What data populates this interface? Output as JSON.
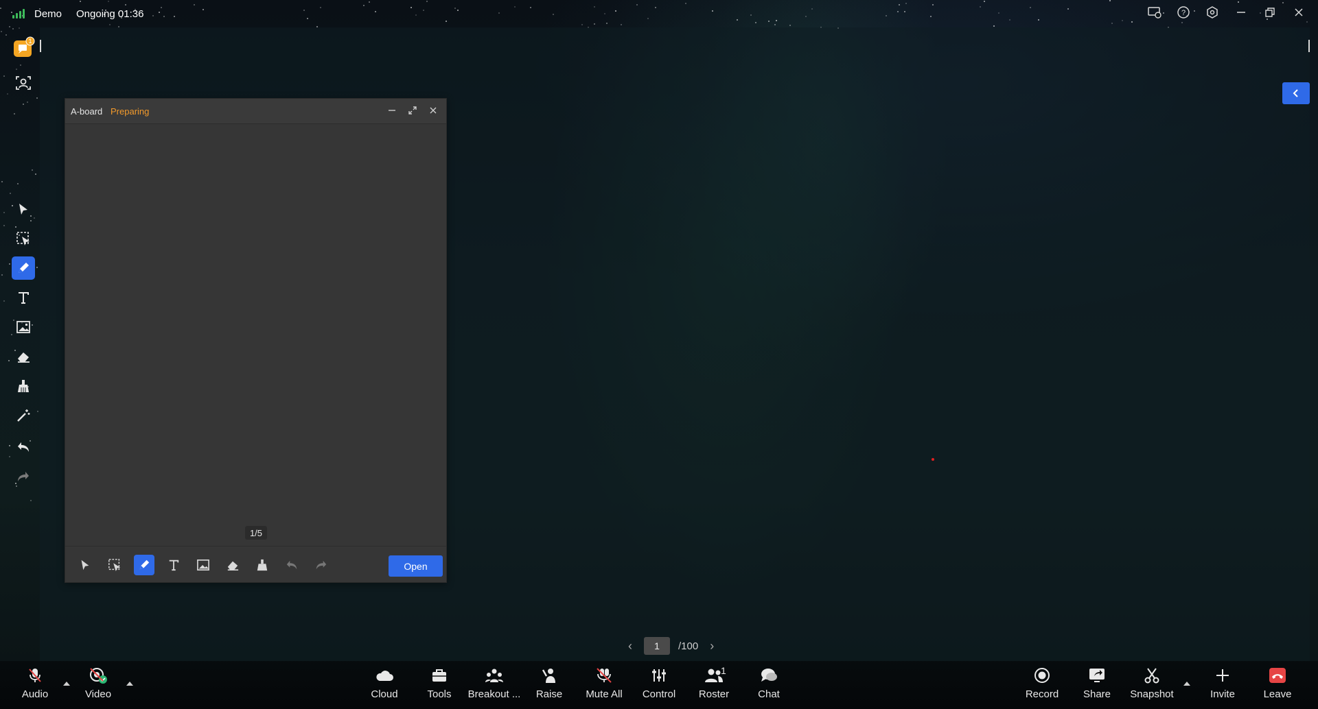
{
  "topbar": {
    "meeting_name": "Demo",
    "meeting_status": "Ongoing 01:36",
    "icons": [
      "screen-share-icon",
      "help-icon",
      "settings-icon",
      "minimize-icon",
      "restore-icon",
      "close-icon"
    ]
  },
  "notification": {
    "badge": "1"
  },
  "left_tools": [
    "select-icon",
    "lasso-select-icon",
    "pen-icon",
    "text-icon",
    "image-icon",
    "eraser-icon",
    "clear-icon",
    "laser-pointer-icon",
    "undo-icon",
    "redo-icon"
  ],
  "aboard": {
    "title": "A-board",
    "status": "Preparing",
    "page_indicator": "1/5",
    "open_label": "Open",
    "tools": [
      "select-icon",
      "lasso-select-icon",
      "pen-icon",
      "text-icon",
      "image-icon",
      "eraser-icon",
      "clear-icon",
      "undo-icon",
      "redo-icon"
    ]
  },
  "pager": {
    "current": "1",
    "total": "/100"
  },
  "bottom": {
    "audio": "Audio",
    "video": "Video",
    "cloud": "Cloud",
    "tools": "Tools",
    "breakout": "Breakout ...",
    "raise": "Raise",
    "mute_all": "Mute All",
    "control": "Control",
    "roster": "Roster",
    "roster_count": "1",
    "chat": "Chat",
    "record": "Record",
    "share": "Share",
    "snapshot": "Snapshot",
    "invite": "Invite",
    "leave": "Leave"
  },
  "colors": {
    "accent": "#2f6ae8",
    "status_orange": "#f39a2b",
    "leave_red": "#e64545",
    "signal_green": "#3dbb5a"
  }
}
